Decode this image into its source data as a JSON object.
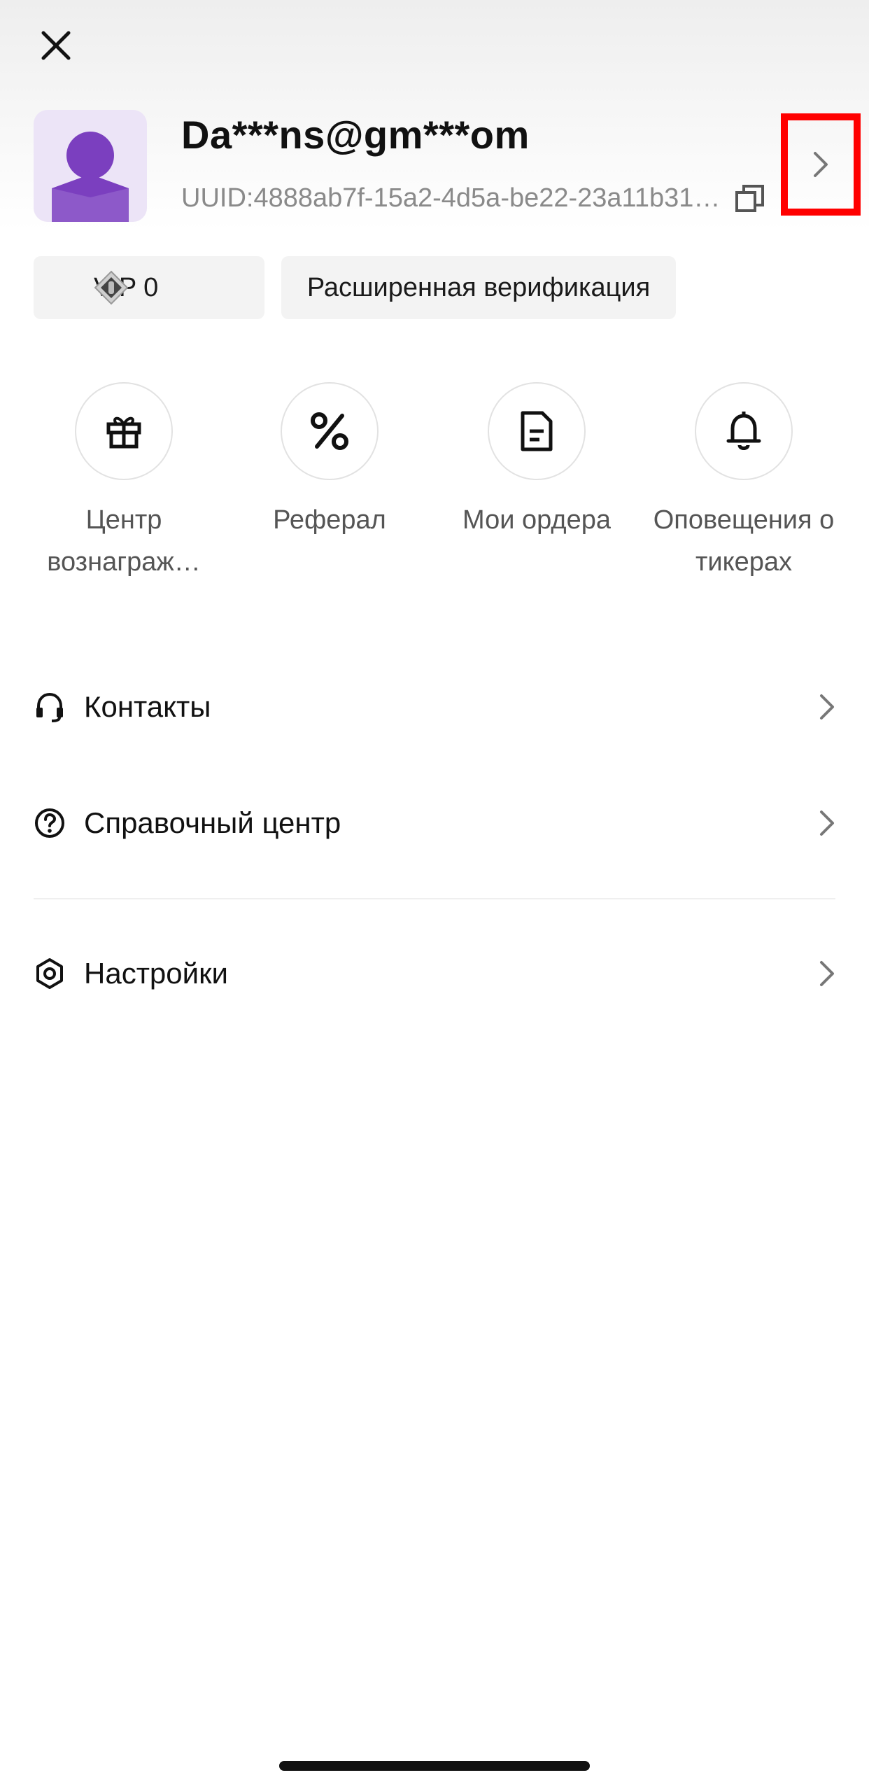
{
  "profile": {
    "email": "Da***ns@gm***om",
    "uid": "UUID:4888ab7f-15a2-4d5a-be22-23a11b31…"
  },
  "badges": {
    "vip": "VIP 0",
    "verification": "Расширенная верификация"
  },
  "quick_actions": [
    {
      "label": "Центр вознаграж…",
      "icon": "gift-icon"
    },
    {
      "label": "Реферал",
      "icon": "percent-icon"
    },
    {
      "label": "Мои ордера",
      "icon": "document-icon"
    },
    {
      "label": "Оповещения о тикерах",
      "icon": "bell-icon"
    }
  ],
  "menu": {
    "contacts": "Контакты",
    "help": "Справочный центр",
    "settings": "Настройки"
  },
  "colors": {
    "avatar_purple": "#7b3fbf",
    "avatar_bg": "#ece4f7",
    "highlight_red": "#ff0000"
  }
}
